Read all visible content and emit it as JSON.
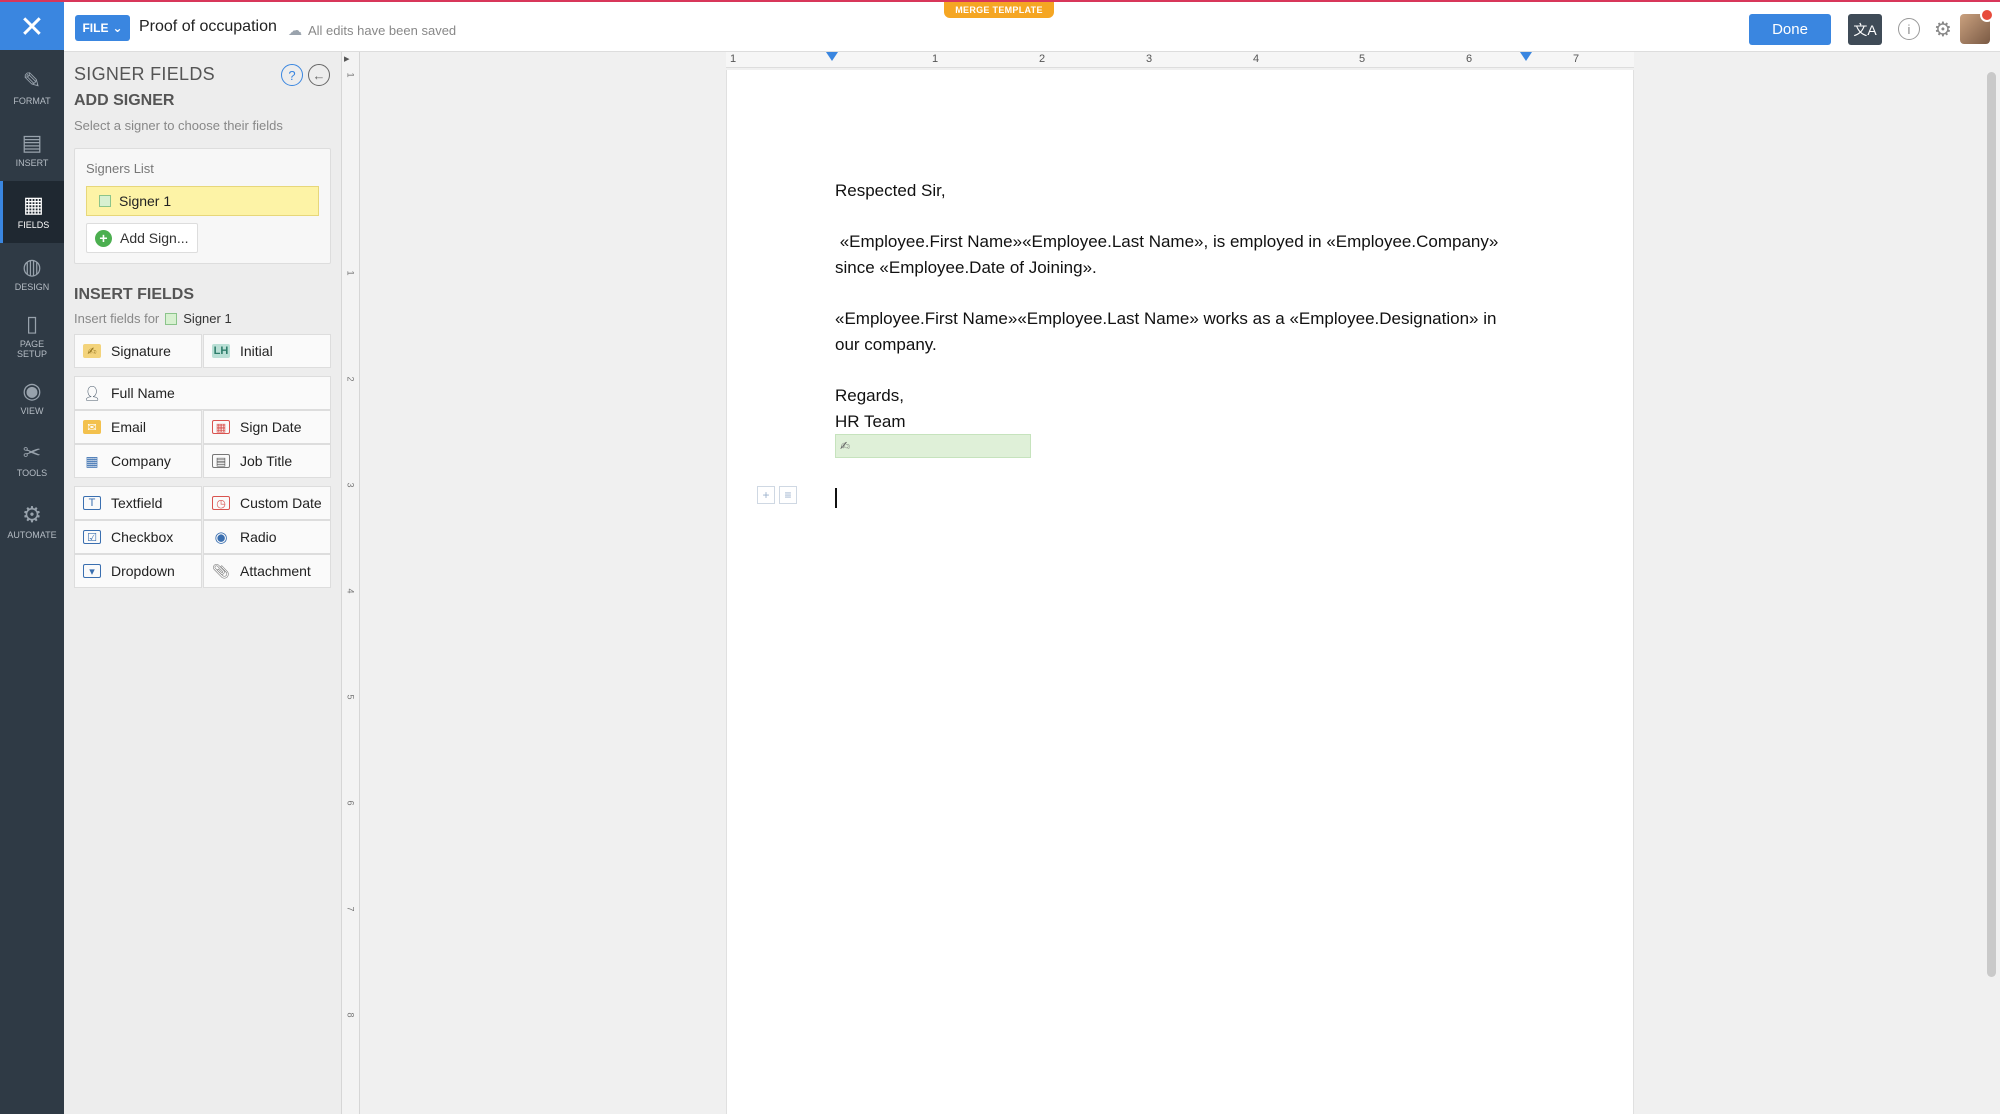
{
  "topbar": {
    "close_label": "✕",
    "file_label": "FILE",
    "doc_title": "Proof of occupation",
    "save_status": "All edits have been saved",
    "merge_tag": "MERGE TEMPLATE",
    "done_label": "Done",
    "translate_glyph": "文A",
    "info_glyph": "i",
    "settings_glyph": "⚙"
  },
  "rail": {
    "items": [
      {
        "label": "FORMAT",
        "icon": "✎"
      },
      {
        "label": "INSERT",
        "icon": "▤"
      },
      {
        "label": "FIELDS",
        "icon": "▦"
      },
      {
        "label": "DESIGN",
        "icon": "◍"
      },
      {
        "label": "PAGE SETUP",
        "icon": "▯"
      },
      {
        "label": "VIEW",
        "icon": "◉"
      },
      {
        "label": "TOOLS",
        "icon": "✂"
      },
      {
        "label": "AUTOMATE",
        "icon": "⚙"
      }
    ]
  },
  "panel": {
    "title": "SIGNER FIELDS",
    "help_glyph": "?",
    "back_glyph": "←",
    "add_signer_heading": "ADD SIGNER",
    "add_signer_sub": "Select a signer to choose their fields",
    "signers_list_label": "Signers List",
    "signer_name": "Signer 1",
    "add_signer_button": "Add Sign...",
    "insert_heading": "INSERT FIELDS",
    "insert_sub": "Insert fields for",
    "insert_signer": "Signer 1",
    "fields": {
      "signature": "Signature",
      "initial": "Initial",
      "full_name": "Full Name",
      "email": "Email",
      "sign_date": "Sign Date",
      "company": "Company",
      "job_title": "Job Title",
      "textfield": "Textfield",
      "custom_date": "Custom Date",
      "checkbox": "Checkbox",
      "radio": "Radio",
      "dropdown": "Dropdown",
      "attachment": "Attachment"
    }
  },
  "ruler": {
    "h_labels": [
      "1",
      "1",
      "2",
      "3",
      "4",
      "5",
      "6",
      "7"
    ],
    "v_labels": [
      "1",
      "1",
      "2",
      "3",
      "4",
      "5",
      "6",
      "7",
      "8"
    ]
  },
  "document": {
    "salutation": "Respected Sir,",
    "para1_line1": " «Employee.First Name»«Employee.Last Name», is employed in «Employee.Company»",
    "para1_line2": "since «Employee.Date of Joining».",
    "para2_line1": "«Employee.First Name»«Employee.Last Name» works as a «Employee.Designation» in",
    "para2_line2": "our company.",
    "closing": "Regards,",
    "signoff": "HR Team"
  },
  "colors": {
    "accent": "#3a86e0",
    "rail_bg": "#2f3a45",
    "signer_highlight": "#fdf3a6",
    "signature_placeholder": "#dff0d8",
    "merge_tag": "#f5a623"
  }
}
